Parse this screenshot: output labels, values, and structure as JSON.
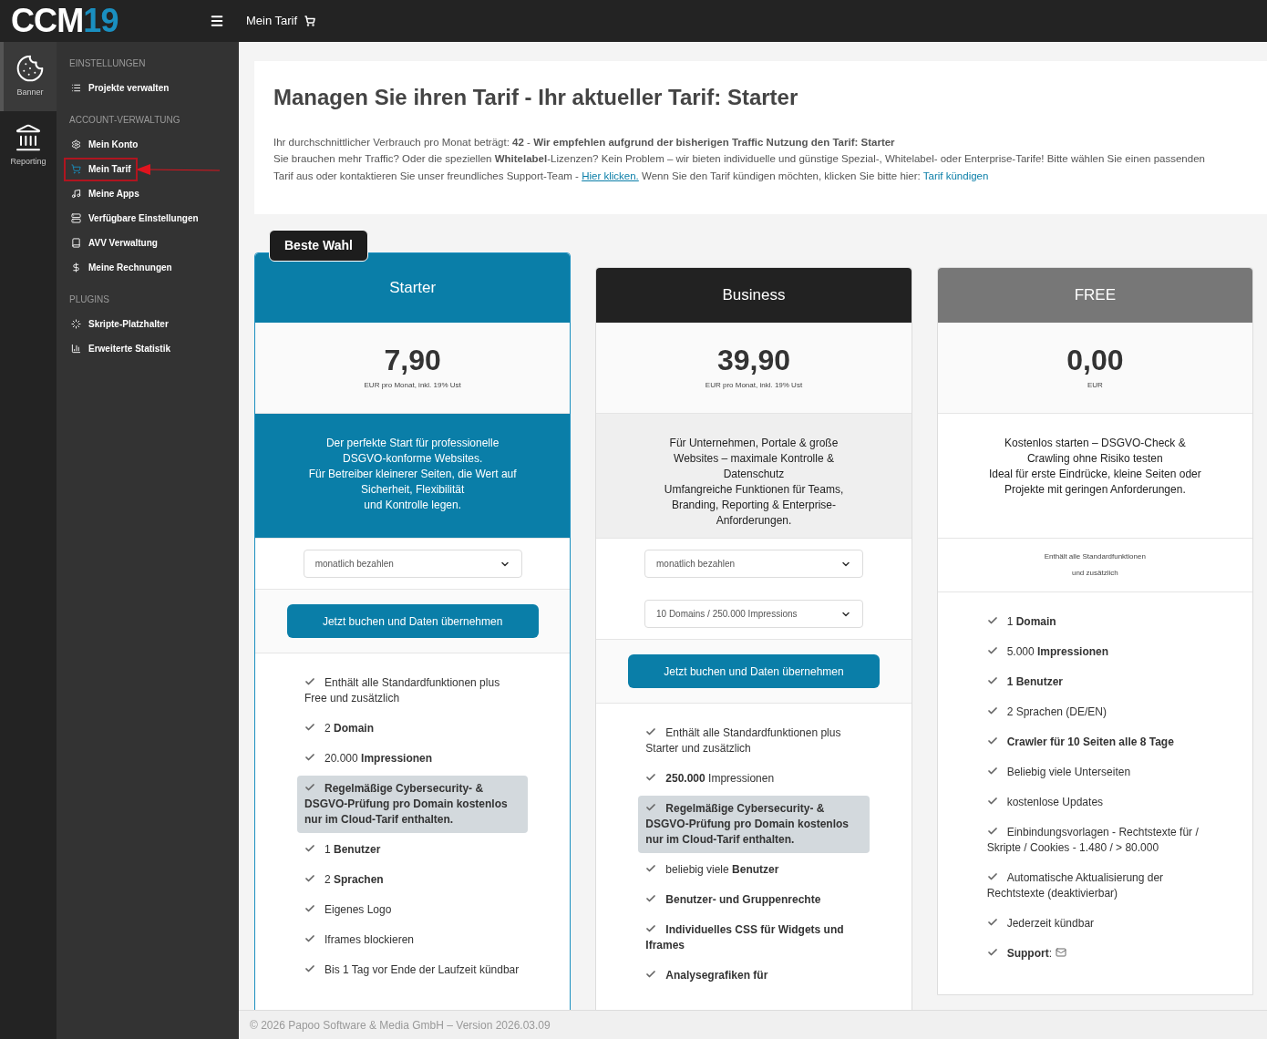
{
  "logo": {
    "text": "CCM",
    "accent": "19"
  },
  "topbar": {
    "title": "Mein Tarif"
  },
  "rail": [
    {
      "label": "Banner",
      "selected": true
    },
    {
      "label": "Reporting",
      "selected": false
    }
  ],
  "sidebar": {
    "sections": [
      {
        "title": "EINSTELLUNGEN",
        "items": [
          {
            "label": "Projekte verwalten",
            "selected": false
          }
        ]
      },
      {
        "title": "ACCOUNT-VERWALTUNG",
        "items": [
          {
            "label": "Mein Konto",
            "selected": false
          },
          {
            "label": "Mein Tarif",
            "selected": true
          },
          {
            "label": "Meine Apps",
            "selected": false
          },
          {
            "label": "Verfügbare Einstellungen",
            "selected": false
          },
          {
            "label": "AVV Verwaltung",
            "selected": false
          },
          {
            "label": "Meine Rechnungen",
            "selected": false
          }
        ]
      },
      {
        "title": "PLUGINS",
        "items": [
          {
            "label": "Skripte-Platzhalter",
            "selected": false
          },
          {
            "label": "Erweiterte Statistik",
            "selected": false
          }
        ]
      }
    ]
  },
  "intro": {
    "title": "Managen Sie ihren Tarif - Ihr aktueller Tarif: Starter",
    "line1": "Ihr durchschnittlicher Verbrauch pro Monat beträgt: **42** - **Wir empfehlen aufgrund der bisherigen Traffic Nutzung den Tarif: Starter**",
    "line2": "Sie brauchen mehr Traffic? Oder die speziellen **Whitelabel**-Lizenzen? Kein Problem – wir bieten individuelle und günstige Spezial-, Whitelabel- oder Enterprise-Tarife! Bitte wählen Sie einen passenden Tarif aus oder kontaktieren Sie unser freundliches Support-Team -",
    "link1": "Hier klicken.",
    "line3": "Wenn Sie den Tarif kündigen möchten, klicken Sie bitte hier:",
    "link2": "Tarif kündigen"
  },
  "plans": [
    {
      "kind": "featured",
      "badge": "Beste Wahl",
      "name": "Starter",
      "color": "#0a7ea8",
      "price": "7,90",
      "price_note": "EUR pro Monat, inkl. 19% Ust",
      "description": [
        "Der perfekte Start für professionelle",
        "DSGVO-konforme Websites.",
        "Für Betreiber kleinerer Seiten, die Wert auf",
        "Sicherheit, Flexibilität",
        "und Kontrolle legen."
      ],
      "selects": [
        "monatlich bezahlen"
      ],
      "button": "Jetzt buchen und Daten übernehmen",
      "features": [
        {
          "text": "Enthält alle Standardfunktionen plus Free und zusätzlich",
          "highlighted": false
        },
        {
          "text": "2 **Domain**",
          "highlighted": false
        },
        {
          "text": "20.000 **Impressionen**",
          "highlighted": false
        },
        {
          "text": "**Regelmäßige Cybersecurity- & DSGVO-Prüfung pro Domain kostenlos nur im Cloud-Tarif enthalten.**",
          "highlighted": true
        },
        {
          "text": "1 **Benutzer**",
          "highlighted": false
        },
        {
          "text": "2 **Sprachen**",
          "highlighted": false
        },
        {
          "text": "Eigenes Logo",
          "highlighted": false
        },
        {
          "text": "Iframes blockieren",
          "highlighted": false
        },
        {
          "text": "Bis 1 Tag vor Ende der Laufzeit kündbar",
          "highlighted": false
        }
      ]
    },
    {
      "kind": "standard",
      "name": "Business",
      "color": "#222222",
      "price": "39,90",
      "price_note": "EUR pro Monat, inkl. 19% Ust",
      "description": [
        "Für Unternehmen, Portale & große",
        "Websites – maximale Kontrolle &",
        "Datenschutz",
        "Umfangreiche Funktionen für Teams,",
        "Branding, Reporting & Enterprise-",
        "Anforderungen."
      ],
      "selects": [
        "monatlich bezahlen",
        "10 Domains / 250.000 Impressions"
      ],
      "button": "Jetzt buchen und Daten übernehmen",
      "features": [
        {
          "text": "Enthält alle Standardfunktionen plus Starter und zusätzlich",
          "highlighted": false
        },
        {
          "text": "**250.000** Impressionen",
          "highlighted": false
        },
        {
          "text": "**Regelmäßige Cybersecurity- & DSGVO-Prüfung pro Domain kostenlos nur im Cloud-Tarif enthalten.**",
          "highlighted": true
        },
        {
          "text": "beliebig viele **Benutzer**",
          "highlighted": false
        },
        {
          "text": "**Benutzer- und Gruppenrechte**",
          "highlighted": false
        },
        {
          "text": "**Individuelles CSS für Widgets und Iframes**",
          "highlighted": false
        },
        {
          "text": "**Analysegrafiken für**",
          "highlighted": false
        }
      ]
    },
    {
      "kind": "free",
      "name": "FREE",
      "color": "#777777",
      "price": "0,00",
      "price_note": "EUR",
      "description": [
        "Kostenlos starten – DSGVO-Check &",
        "Crawling ohne Risiko testen",
        "Ideal für erste Eindrücke, kleine Seiten oder",
        "Projekte mit geringen Anforderungen."
      ],
      "note": [
        "Enthält alle Standardfunktionen",
        "und zusätzlich"
      ],
      "features": [
        {
          "text": "1 **Domain**",
          "highlighted": false
        },
        {
          "text": "5.000 **Impressionen**",
          "highlighted": false
        },
        {
          "text": "**1 Benutzer**",
          "highlighted": false
        },
        {
          "text": "2 Sprachen (DE/EN)",
          "highlighted": false
        },
        {
          "text": "**Crawler für 10 Seiten alle 8 Tage**",
          "highlighted": false
        },
        {
          "text": "Beliebig viele Unterseiten",
          "highlighted": false
        },
        {
          "text": "kostenlose Updates",
          "highlighted": false
        },
        {
          "text": "Einbindungsvorlagen - Rechtstexte für / Skripte / Cookies - 1.480 / > 80.000",
          "highlighted": false
        },
        {
          "text": "Automatische Aktualisierung der Rechtstexte (deaktivierbar)",
          "highlighted": false
        },
        {
          "text": "Jederzeit kündbar",
          "highlighted": false
        },
        {
          "text": "**Support**:",
          "highlighted": false,
          "mail_icon": true
        }
      ]
    }
  ],
  "footer": "© 2026 Papoo Software & Media GmbH – Version 2026.03.09"
}
